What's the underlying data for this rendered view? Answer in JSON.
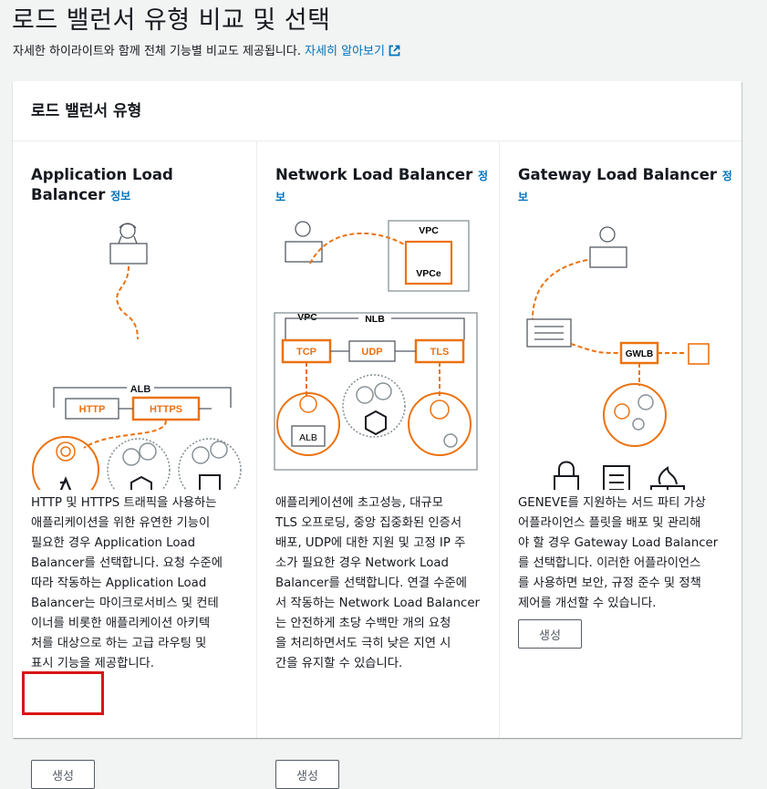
{
  "page": {
    "title": "로드 밸런서 유형 비교 및 선택",
    "subtitle": "자세한 하이라이트와 함께 전체 기능별 비교도 제공됩니다.",
    "learn_more": "자세히 알아보기"
  },
  "panel": {
    "title": "로드 밸런서 유형",
    "columns": [
      {
        "title_line1": "Application Load",
        "title_line2": "Balancer",
        "info": "정보",
        "diagram": {
          "group": "ALB",
          "protocols": [
            "HTTP",
            "HTTPS"
          ],
          "targets": [
            "lambda",
            "container",
            "chip"
          ]
        },
        "description": [
          "HTTP 및 HTTPS 트래픽을 사용하는",
          "애플리케이션을 위한 유연한 기능이",
          "필요한 경우 Application Load",
          "Balancer를 선택합니다. 요청 수준에",
          "따라 작동하는 Application Load",
          "Balancer는 마이크로서비스 및 컨테",
          "이너를 비롯한 애플리케이션 아키텍",
          "처를 대상으로 하는 고급 라우팅 및",
          "표시 기능을 제공합니다."
        ],
        "button": "생성"
      },
      {
        "title_line1": "Network Load Balancer",
        "info_line1": "정",
        "info_line2": "보",
        "diagram": {
          "outer": "VPC",
          "endpoint_group": "VPC",
          "endpoint": "VPCe",
          "group": "NLB",
          "protocols": [
            "TCP",
            "UDP",
            "TLS"
          ],
          "targets": [
            "ALB",
            "container",
            "target"
          ]
        },
        "description": [
          "애플리케이션에 초고성능, 대규모",
          "TLS 오프로딩, 중앙 집중화된 인증서",
          "배포, UDP에 대한 지원 및 고정 IP 주",
          "소가 필요한 경우 Network Load",
          "Balancer를 선택합니다. 연결 수준에",
          "서 작동하는 Network Load Balancer",
          "는 안전하게 초당 수백만 개의 요청",
          "을 처리하면서도 극히 낮은 지연 시",
          "간을 유지할 수 있습니다."
        ],
        "button": "생성"
      },
      {
        "title_line1": "Gateway Load Balancer",
        "info_line1": "정",
        "info_line2": "보",
        "diagram": {
          "gateway": "GWLB",
          "appliances": [
            "lock",
            "checklist",
            "firewall"
          ]
        },
        "description": [
          "GENEVE를 지원하는 서드 파티 가상",
          "어플라이언스 플릿을 배포 및 관리해",
          "야 할 경우 Gateway Load Balancer",
          "를 선택합니다. 이러한 어플라이언스",
          "를 사용하면 보안, 규정 준수 및 정책",
          "제어를 개선할 수 있습니다."
        ],
        "button": "생성"
      }
    ]
  },
  "colors": {
    "accent": "#ec7211",
    "link": "#0073bb",
    "highlight": "#d91515",
    "text": "#16191f"
  }
}
